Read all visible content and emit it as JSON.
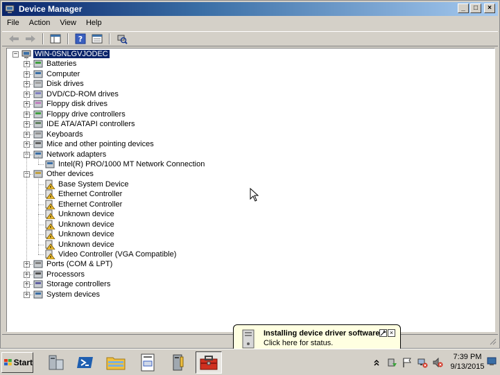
{
  "window": {
    "title": "Device Manager"
  },
  "menu": [
    "File",
    "Action",
    "View",
    "Help"
  ],
  "tree": {
    "root": "WIN-0SNLGVJODEC",
    "categories": [
      {
        "label": "Batteries",
        "icon": "battery-icon"
      },
      {
        "label": "Computer",
        "icon": "computer-icon"
      },
      {
        "label": "Disk drives",
        "icon": "disk-drive-icon"
      },
      {
        "label": "DVD/CD-ROM drives",
        "icon": "dvd-drive-icon"
      },
      {
        "label": "Floppy disk drives",
        "icon": "floppy-disk-icon"
      },
      {
        "label": "Floppy drive controllers",
        "icon": "floppy-controller-icon"
      },
      {
        "label": "IDE ATA/ATAPI controllers",
        "icon": "ide-controller-icon"
      },
      {
        "label": "Keyboards",
        "icon": "keyboard-icon"
      },
      {
        "label": "Mice and other pointing devices",
        "icon": "mouse-icon"
      },
      {
        "label": "Network adapters",
        "icon": "network-adapter-icon",
        "expanded": true,
        "children": [
          {
            "label": "Intel(R) PRO/1000 MT Network Connection",
            "icon": "network-card-icon"
          }
        ]
      },
      {
        "label": "Other devices",
        "icon": "other-devices-icon",
        "expanded": true,
        "children": [
          {
            "label": "Base System Device",
            "icon": "unknown-device-warning-icon"
          },
          {
            "label": "Ethernet Controller",
            "icon": "unknown-device-warning-icon"
          },
          {
            "label": "Ethernet Controller",
            "icon": "unknown-device-warning-icon"
          },
          {
            "label": "Unknown device",
            "icon": "unknown-device-warning-icon"
          },
          {
            "label": "Unknown device",
            "icon": "unknown-device-warning-icon"
          },
          {
            "label": "Unknown device",
            "icon": "unknown-device-warning-icon"
          },
          {
            "label": "Unknown device",
            "icon": "unknown-device-warning-icon"
          },
          {
            "label": "Video Controller (VGA Compatible)",
            "icon": "unknown-device-warning-icon"
          }
        ]
      },
      {
        "label": "Ports (COM & LPT)",
        "icon": "port-icon"
      },
      {
        "label": "Processors",
        "icon": "processor-icon"
      },
      {
        "label": "Storage controllers",
        "icon": "storage-controller-icon"
      },
      {
        "label": "System devices",
        "icon": "system-device-icon"
      }
    ]
  },
  "balloon": {
    "title": "Installing device driver software",
    "text": "Click here for status."
  },
  "taskbar": {
    "start_label": "Start",
    "time": "7:39 PM",
    "date": "9/13/2015"
  },
  "colors": {
    "selection": "#0a246a",
    "titlebar_start": "#0a246a",
    "titlebar_end": "#a6caf0",
    "balloon_bg": "#ffffe1"
  }
}
